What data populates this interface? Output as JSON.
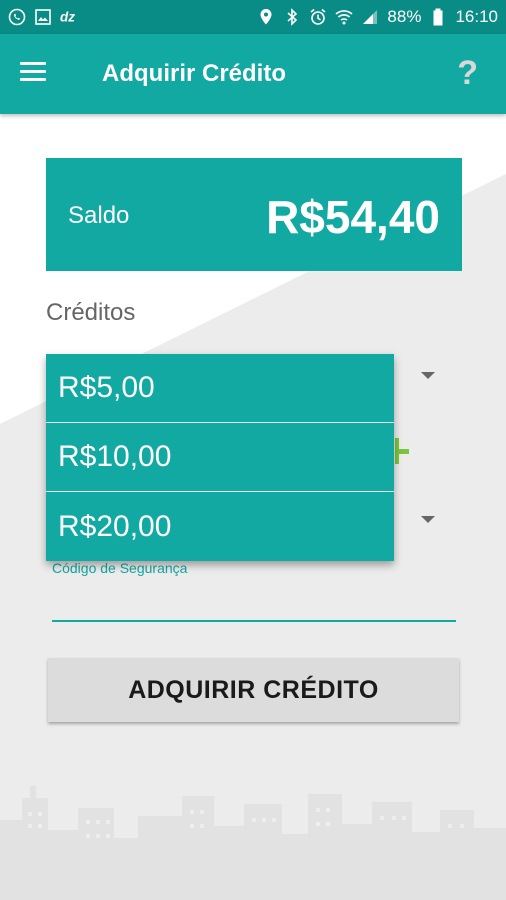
{
  "status_bar": {
    "left_icons": [
      "whatsapp-icon",
      "image-icon",
      "dz-app-icon"
    ],
    "right_icons": [
      "location-icon",
      "bluetooth-icon",
      "alarm-icon",
      "wifi-icon",
      "signal-icon",
      "battery-icon"
    ],
    "battery": "88%",
    "time": "16:10"
  },
  "toolbar": {
    "title": "Adquirir Crédito",
    "help_label": "?"
  },
  "saldo": {
    "label": "Saldo",
    "value": "R$54,40"
  },
  "creditos": {
    "label": "Créditos",
    "options": [
      "R$5,00",
      "R$10,00",
      "R$20,00"
    ]
  },
  "codigo": {
    "label": "Código de Segurança"
  },
  "actions": {
    "adquirir_label": "ADQUIRIR CRÉDITO"
  },
  "colors": {
    "primary": "#11a9a2",
    "primary_dark": "#0a8c86",
    "accent_green": "#7cc53f"
  }
}
